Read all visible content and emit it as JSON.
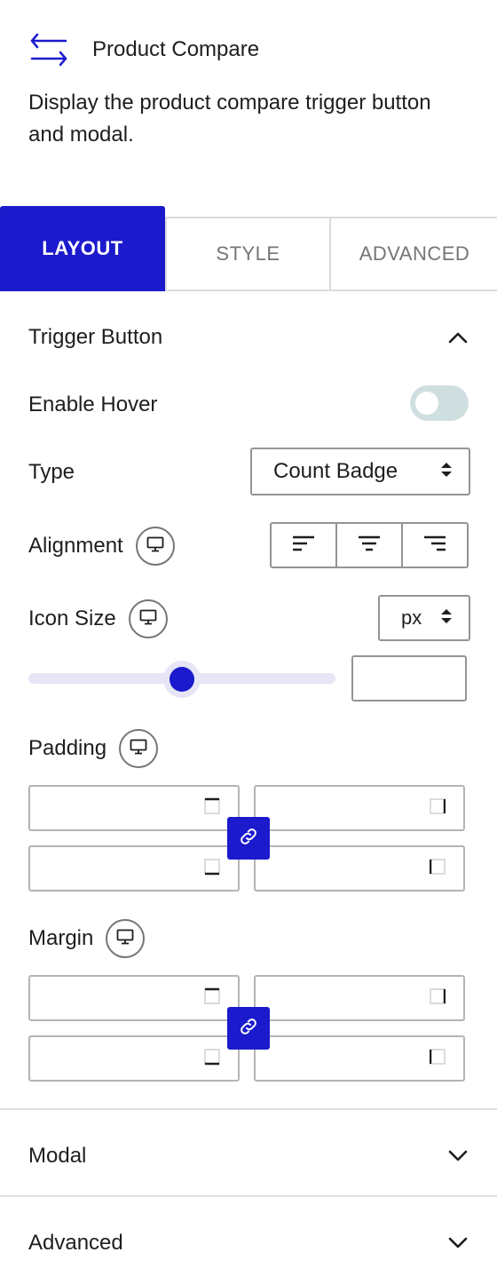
{
  "block": {
    "icon": "arrows-swap-icon",
    "title": "Product Compare",
    "description": "Display the product compare trigger button and modal."
  },
  "tabs": [
    {
      "label": "LAYOUT",
      "active": true
    },
    {
      "label": "STYLE",
      "active": false
    },
    {
      "label": "ADVANCED",
      "active": false
    }
  ],
  "trigger_panel": {
    "title": "Trigger Button",
    "expanded": true,
    "enable_hover": {
      "label": "Enable Hover",
      "checked": false
    },
    "type": {
      "label": "Type",
      "value": "Count Badge"
    },
    "alignment": {
      "label": "Alignment",
      "options": [
        "left",
        "center",
        "right"
      ]
    },
    "icon_size": {
      "label": "Icon Size",
      "unit": "px",
      "value": "",
      "slider_fraction": 0.5
    },
    "padding": {
      "label": "Padding",
      "top": "",
      "right": "",
      "bottom": "",
      "left": "",
      "linked": true
    },
    "margin": {
      "label": "Margin",
      "top": "",
      "right": "",
      "bottom": "",
      "left": "",
      "linked": true
    }
  },
  "modal_panel": {
    "title": "Modal",
    "expanded": false
  },
  "advanced_panel": {
    "title": "Advanced",
    "expanded": false
  },
  "colors": {
    "accent": "#1b1acd",
    "toggle_off": "#cfdfdf",
    "track": "#e5e5f5"
  }
}
